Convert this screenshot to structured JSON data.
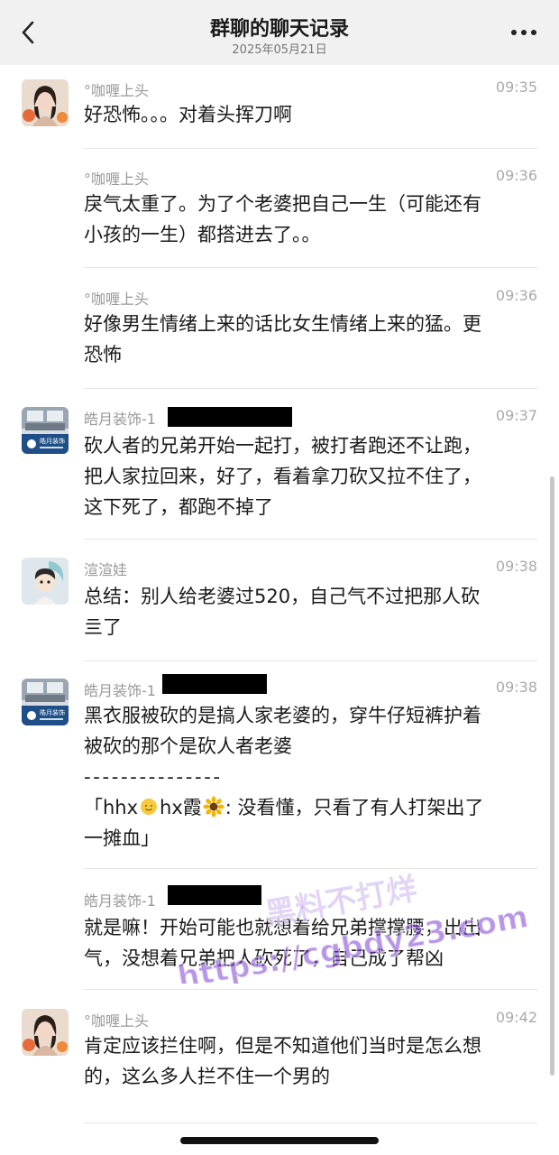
{
  "header": {
    "title": "群聊的聊天记录",
    "date": "2025年05月21日",
    "back_icon": "chevron-left-icon",
    "more_icon": "ellipsis-icon"
  },
  "messages": [
    {
      "sender": "°咖喱上头",
      "time": "09:35",
      "avatar": "girl-portrait",
      "lines": [
        "好恐怖。。。对着头挥刀啊"
      ]
    },
    {
      "sender": "°咖喱上头",
      "time": "09:36",
      "lines": [
        "戾气太重了。为了个老婆把自己一生（可能还有",
        "小孩的一生）都搭进去了。。"
      ]
    },
    {
      "sender": "°咖喱上头",
      "time": "09:36",
      "lines": [
        "好像男生情绪上来的话比女生情绪上来的猛。更",
        "恐怖"
      ]
    },
    {
      "sender": "皓月装饰-1",
      "time": "09:37",
      "avatar": "living-room-logo",
      "redacted": true,
      "lines": [
        "砍人者的兄弟开始一起打，被打者跑还不让跑，",
        "把人家拉回来，好了，看着拿刀砍又拉不住了，",
        "这下死了，都跑不掉了"
      ]
    },
    {
      "sender": "渲渲娃",
      "time": "09:38",
      "avatar": "cartoon-boy",
      "lines": [
        "总结：别人给老婆过520，自己气不过把那人砍",
        "亖了"
      ]
    },
    {
      "sender": "皓月装饰-1",
      "time": "09:38",
      "avatar": "living-room-logo",
      "redacted": true,
      "lines": [
        "黑衣服被砍的是搞人家老婆的，穿牛仔短裤护着",
        "被砍的那个是砍人者老婆",
        "- - - - - - - - - - - - - - -"
      ],
      "quote": {
        "open": "「hhx",
        "mid": "hx霞",
        "rest": ": 没看懂，只看了有人打架出了",
        "line2": "一摊血」"
      }
    },
    {
      "sender": "皓月装饰-1",
      "time": "",
      "redacted": true,
      "lines": [
        "就是嘛！开始可能也就想着给兄弟撑撑腰，出出",
        "气，没想着兄弟把人砍死了，自己成了帮凶"
      ]
    },
    {
      "sender": "°咖喱上头",
      "time": "09:42",
      "avatar": "girl-portrait",
      "lines": [
        "肯定应该拦住啊，但是不知道他们当时是怎么想",
        "的，这么多人拦不住一个男的"
      ]
    }
  ],
  "avatar_brand": "皓月装饰",
  "watermark": {
    "line1": "黑料不打烊",
    "line2": "https://cgbdy23.com"
  }
}
